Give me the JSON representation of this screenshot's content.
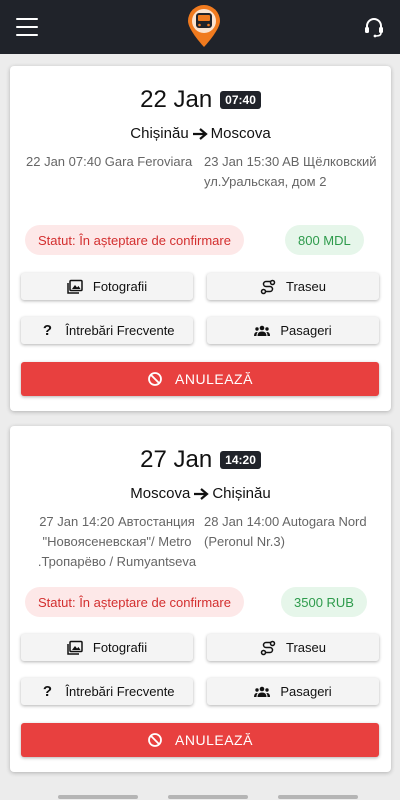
{
  "header": {
    "menu_icon": "hamburger-icon",
    "logo_icon": "bus-pin-logo",
    "support_icon": "headset-icon",
    "colors": {
      "bar": "#20232a",
      "logo_orange": "#f07a1e"
    }
  },
  "bookings": [
    {
      "date": "22 Jan",
      "time": "07:40",
      "from_city": "Chișinău",
      "to_city": "Moscova",
      "departure": "22 Jan 07:40 Gara Feroviara",
      "arrival": "23 Jan 15:30 AB Щёлковский ул.Уральская, дом 2",
      "status": "Statut: În așteptare de confirmare",
      "price": "800 MDL",
      "buttons": {
        "photos": "Fotografii",
        "route": "Traseu",
        "faq": "Întrebări Frecvente",
        "passengers": "Pasageri",
        "cancel": "ANULEAZĂ"
      }
    },
    {
      "date": "27 Jan",
      "time": "14:20",
      "from_city": "Moscova",
      "to_city": "Chișinău",
      "departure": "27 Jan 14:20 Автостанция \"Новоясеневская\"/ Metro .Тропарёво / Rumyantseva",
      "arrival": "28 Jan 14:00 Autogara Nord (Peronul Nr.3)",
      "status": "Statut: În așteptare de confirmare",
      "price": "3500 RUB",
      "buttons": {
        "photos": "Fotografii",
        "route": "Traseu",
        "faq": "Întrebări Frecvente",
        "passengers": "Pasageri",
        "cancel": "ANULEAZĂ"
      }
    }
  ],
  "colors": {
    "status_bg": "#fde8e8",
    "status_text": "#d32f2f",
    "price_bg": "#e6f6ea",
    "price_text": "#2e9b4c",
    "cancel_bg": "#e8403f"
  }
}
